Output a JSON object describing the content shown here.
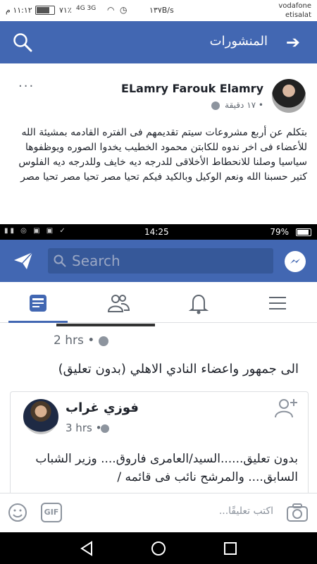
{
  "status_bar_top": {
    "time": "١١:١٢ م",
    "battery_percent": "٧١٪",
    "network_speed": "١٣٧B/s",
    "signal_labels": "4G 3G",
    "carrier_line1": "vodafone",
    "carrier_line2": "etisalat"
  },
  "header_top": {
    "title": "المنشورات"
  },
  "post": {
    "author": "ELamry Farouk Elamry",
    "time": "١٧ دقيقة •",
    "more": "···",
    "body": "بتكلم عن أربع مشروعات سيتم تقديمهم فى الفتره القادمه بمشيئة الله للأعضاء  فى اخر ندوه للكابتن محمود الخطيب يخدوا الصوره ويوظفوها سياسيا وصلنا للانحطاط الأخلاقى للدرجه ديه خايف وللدرجه ديه الفلوس كتير  حسبنا الله ونعم الوكيل وبالكيد فيكم تحيا مصر تحيا مصر تحيا مصر"
  },
  "status_bar_second": {
    "time": "14:25",
    "battery_percent": "79%"
  },
  "header_search": {
    "placeholder": "Search"
  },
  "feed": {
    "shared_time": "2 hrs •",
    "shared_caption": "الى جمهور واعضاء النادي الاهلي (بدون تعليق)",
    "inner_post": {
      "author": "فوزي غراب",
      "time": "3 hrs •",
      "body": "بدون تعليق......السيد/العامرى فاروق.... وزير الشباب السابق.... والمرشح نائب فى قائمه /"
    }
  },
  "comment_bar": {
    "gif_label": "GIF",
    "placeholder": "اكتب تعليقًا..."
  },
  "colors": {
    "brand_blue": "#4267b2",
    "search_box": "#365899"
  }
}
